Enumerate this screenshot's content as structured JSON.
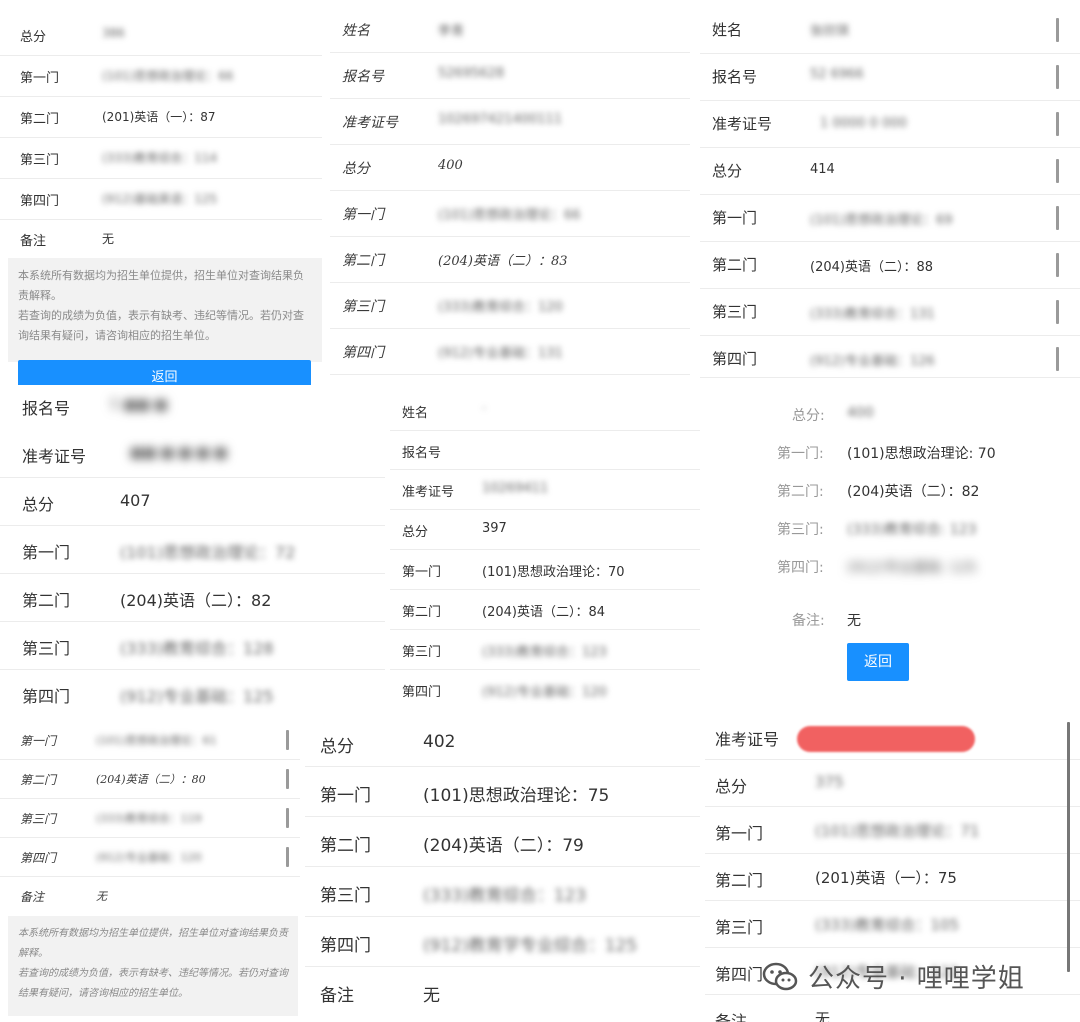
{
  "p1": {
    "rows": [
      {
        "label": "总分",
        "value": "386"
      },
      {
        "label": "第一门",
        "value": "(101)思想政治理论：66"
      },
      {
        "label": "第二门",
        "value": "(201)英语（一）：87"
      },
      {
        "label": "第三门",
        "value": "(333)教育综合：114"
      },
      {
        "label": "第四门",
        "value": "(912)基础英语：125"
      },
      {
        "label": "备注",
        "value": "无"
      }
    ],
    "notice": [
      "本系统所有数据均为招生单位提供，招生单位对查询结果负责解释。",
      "若查询的成绩为负值，表示有缺考、违纪等情况。若仍对查询结果有疑问，请咨询相应的招生单位。"
    ],
    "button": "返回"
  },
  "p2": {
    "rows": [
      {
        "label": "姓名",
        "value": "李青"
      },
      {
        "label": "报名号",
        "value": "52695628"
      },
      {
        "label": "准考证号",
        "value": "102697421400111"
      },
      {
        "label": "总分",
        "value": "400"
      },
      {
        "label": "第一门",
        "value": "(101)思想政治理论：66"
      },
      {
        "label": "第二门",
        "value": "(204)英语（二）：83"
      },
      {
        "label": "第三门",
        "value": "(333)教育综合：120"
      },
      {
        "label": "第四门",
        "value": "(912)专业基础：131"
      }
    ]
  },
  "p3": {
    "rows": [
      {
        "label": "姓名",
        "value": "张欣琪"
      },
      {
        "label": "报名号",
        "value": "52  6966"
      },
      {
        "label": "准考证号",
        "value": "1 0000 0 000"
      },
      {
        "label": "总分",
        "value": "414"
      },
      {
        "label": "第一门",
        "value": "(101)思想政治理论：69"
      },
      {
        "label": "第二门",
        "value": "(204)英语（二）：88"
      },
      {
        "label": "第三门",
        "value": "(333)教育综合：131"
      },
      {
        "label": "第四门",
        "value": "(912)专业基础：126"
      }
    ]
  },
  "p4": {
    "rows": [
      {
        "label": "报名号",
        "value": "5 ■■ ■"
      },
      {
        "label": "准考证号",
        "value": "■■ ■ ■ ■ ■"
      },
      {
        "label": "总分",
        "value": "407"
      },
      {
        "label": "第一门",
        "value": "(101)思想政治理论：72"
      },
      {
        "label": "第二门",
        "value": "(204)英语（二）：82"
      },
      {
        "label": "第三门",
        "value": "(333)教育综合：128"
      },
      {
        "label": "第四门",
        "value": "(912)专业基础：125"
      }
    ]
  },
  "p5": {
    "rows": [
      {
        "label": "姓名",
        "value": "·"
      },
      {
        "label": "报名号",
        "value": ""
      },
      {
        "label": "准考证号",
        "value": "10269411"
      },
      {
        "label": "总分",
        "value": "397"
      },
      {
        "label": "第一门",
        "value": "(101)思想政治理论：70"
      },
      {
        "label": "第二门",
        "value": "(204)英语（二）：84"
      },
      {
        "label": "第三门",
        "value": "(333)教育综合：123"
      },
      {
        "label": "第四门",
        "value": "(912)专业基础：120"
      }
    ]
  },
  "p6": {
    "rows": [
      {
        "label": "总分:",
        "value": "400"
      },
      {
        "label": "第一门:",
        "value": "(101)思想政治理论: 70"
      },
      {
        "label": "第二门:",
        "value": "(204)英语（二）：82"
      },
      {
        "label": "第三门:",
        "value": "(333)教育综合: 123"
      },
      {
        "label": "第四门:",
        "value": "(912)专业基础: 125"
      }
    ],
    "remark_label": "备注:",
    "remark_value": "无",
    "button": "返回"
  },
  "p7": {
    "rows": [
      {
        "label": "第一门",
        "value": "(101)思想政治理论：61"
      },
      {
        "label": "第二门",
        "value": "(204)英语（二）：80"
      },
      {
        "label": "第三门",
        "value": "(333)教育综合：119"
      },
      {
        "label": "第四门",
        "value": "(912)专业基础：120"
      },
      {
        "label": "备注",
        "value": "无"
      }
    ],
    "notice": [
      "本系统所有数据均为招生单位提供，招生单位对查询结果负责解释。",
      "若查询的成绩为负值，表示有缺考、违纪等情况。若仍对查询结果有疑问，请咨询相应的招生单位。"
    ]
  },
  "p8": {
    "rows": [
      {
        "label": "总分",
        "value": "402"
      },
      {
        "label": "第一门",
        "value": "(101)思想政治理论：75"
      },
      {
        "label": "第二门",
        "value": "(204)英语（二）：79"
      },
      {
        "label": "第三门",
        "value": "(333)教育综合：123"
      },
      {
        "label": "第四门",
        "value": "(912)教育学专业综合：125"
      },
      {
        "label": "备注",
        "value": "无"
      }
    ]
  },
  "p9": {
    "rows": [
      {
        "label": "准考证号",
        "value": ""
      },
      {
        "label": "总分",
        "value": "375"
      },
      {
        "label": "第一门",
        "value": "(101)思想政治理论：71"
      },
      {
        "label": "第二门",
        "value": "(201)英语（一）：75"
      },
      {
        "label": "第三门",
        "value": "(333)教育综合：105"
      },
      {
        "label": "第四门",
        "value": "(912)专业基础：122"
      },
      {
        "label": "备注",
        "value": "无"
      }
    ]
  },
  "watermark": {
    "text": "公众号 · 哩哩学姐",
    "icon": "wechat-icon"
  }
}
